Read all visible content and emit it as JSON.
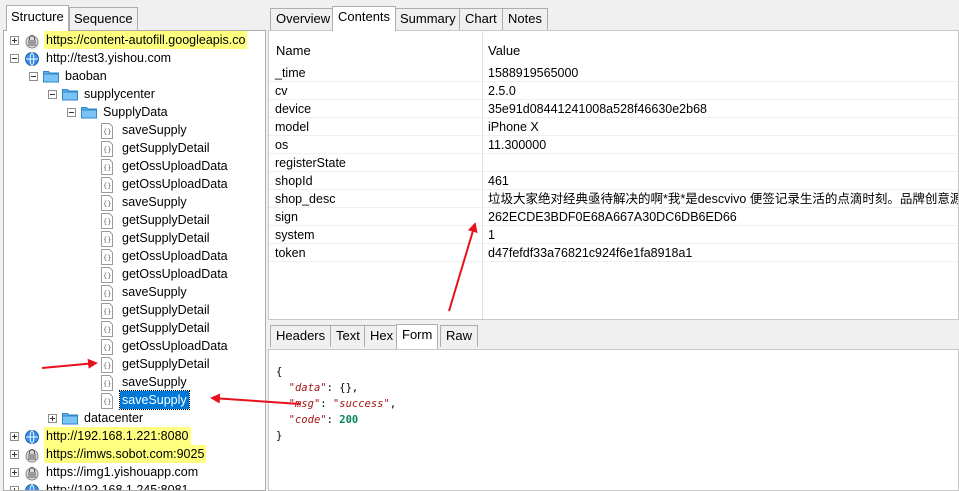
{
  "left_tabs": [
    "Structure",
    "Sequence"
  ],
  "tree": [
    {
      "label": "https://content-autofill.googleapis.co",
      "icon": "lock-globe-icon",
      "highlight": true,
      "expander": "plus"
    },
    {
      "label": "http://test3.yishou.com",
      "icon": "globe-icon",
      "expander": "minus"
    },
    {
      "label": "baoban",
      "icon": "folder-icon",
      "expander": "minus"
    },
    {
      "label": "supplycenter",
      "icon": "folder-icon",
      "expander": "minus"
    },
    {
      "label": "SupplyData",
      "icon": "folder-icon",
      "expander": "minus"
    },
    {
      "label": "saveSupply",
      "icon": "json-file-icon"
    },
    {
      "label": "getSupplyDetail",
      "icon": "json-file-icon"
    },
    {
      "label": "getOssUploadData",
      "icon": "json-file-icon"
    },
    {
      "label": "getOssUploadData",
      "icon": "json-file-icon"
    },
    {
      "label": "saveSupply",
      "icon": "json-file-icon"
    },
    {
      "label": "getSupplyDetail",
      "icon": "json-file-icon"
    },
    {
      "label": "getSupplyDetail",
      "icon": "json-file-icon"
    },
    {
      "label": "getOssUploadData",
      "icon": "json-file-icon"
    },
    {
      "label": "getOssUploadData",
      "icon": "json-file-icon"
    },
    {
      "label": "saveSupply",
      "icon": "json-file-icon"
    },
    {
      "label": "getSupplyDetail",
      "icon": "json-file-icon"
    },
    {
      "label": "getSupplyDetail",
      "icon": "json-file-icon"
    },
    {
      "label": "getOssUploadData",
      "icon": "json-file-icon"
    },
    {
      "label": "getSupplyDetail",
      "icon": "json-file-icon"
    },
    {
      "label": "saveSupply",
      "icon": "json-file-icon"
    },
    {
      "label": "saveSupply",
      "icon": "json-file-icon",
      "selected": true
    },
    {
      "label": "datacenter",
      "icon": "folder-icon",
      "expander": "plus"
    },
    {
      "label": "http://192.168.1.221:8080",
      "icon": "globe-icon",
      "highlight": true,
      "expander": "plus"
    },
    {
      "label": "https://imws.sobot.com:9025",
      "icon": "lock-globe-icon",
      "highlight": true,
      "expander": "plus"
    },
    {
      "label": "https://img1.yishouapp.com",
      "icon": "lock-globe-icon",
      "expander": "plus"
    },
    {
      "label": "http://192.168.1.245:8081",
      "icon": "globe-icon",
      "expander": "plus"
    }
  ],
  "right_tabs": [
    "Overview",
    "Contents",
    "Summary",
    "Chart",
    "Notes"
  ],
  "table": {
    "headers": {
      "name": "Name",
      "value": "Value"
    },
    "rows": [
      {
        "k": "_time",
        "v": "1588919565000"
      },
      {
        "k": "cv",
        "v": "2.5.0"
      },
      {
        "k": "device",
        "v": "35e91d08441241008a528f46630e2b68"
      },
      {
        "k": "model",
        "v": "iPhone X"
      },
      {
        "k": "os",
        "v": "11.300000"
      },
      {
        "k": "registerState",
        "v": ""
      },
      {
        "k": "shopId",
        "v": "461"
      },
      {
        "k": "shop_desc",
        "v": "垃圾大家绝对经典亟待解决的啊*我*是descvivo 便签记录生活的点滴时刻。品牌创意源自"
      },
      {
        "k": "sign",
        "v": "262ECDE3BDF0E68A667A30DC6DB6ED66"
      },
      {
        "k": "system",
        "v": "1"
      },
      {
        "k": "token",
        "v": "d47fefdf33a76821c924f6e1fa8918a1"
      }
    ]
  },
  "sub_tabs": [
    "Headers",
    "Text",
    "Hex",
    "Form",
    "Raw"
  ],
  "response": {
    "open": "{",
    "data_key": "\"data\"",
    "data_val": "{}",
    "msg_key": "\"msg\"",
    "msg_val": "\"success\"",
    "code_key": "\"code\"",
    "code_val": "200",
    "close": "}"
  },
  "colors": {
    "highlight": "#ffff80",
    "selection": "#0078d7",
    "arrow": "#e8101a"
  }
}
